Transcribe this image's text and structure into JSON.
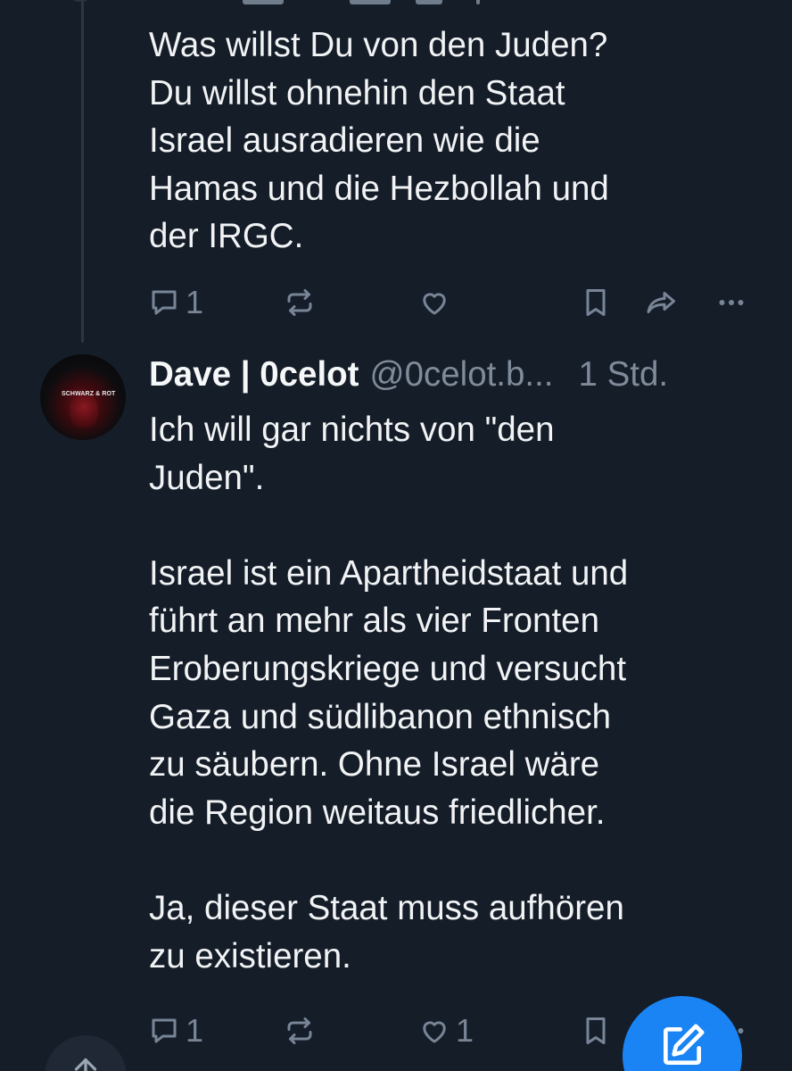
{
  "parent_post": {
    "text": "Was willst Du von den Juden?\nDu willst ohnehin den Staat\nIsrael ausradieren wie die\nHamas und die Hezbollah und\nder IRGC.",
    "reply_count": "1",
    "repost_count": "",
    "like_count": ""
  },
  "reply_post": {
    "author_name": "Dave | 0celot",
    "handle": "@0celot.b...",
    "time": "1 Std.",
    "avatar_text": "SCHWARZ & ROT",
    "text": "Ich will gar nichts von \"den\nJuden\".\n\nIsrael ist ein Apartheidstaat und\nführt an mehr als vier Fronten\nEroberungskriege und versucht\nGaza und südlibanon ethnisch\nzu säubern. Ohne Israel wäre\ndie Region weitaus friedlicher.\n\nJa, dieser Staat muss aufhören\nzu existieren.",
    "reply_count": "1",
    "repost_count": "",
    "like_count": "1"
  },
  "icons": {
    "reply": "speech-bubble-icon",
    "repost": "repost-arrows-icon",
    "like": "heart-icon",
    "bookmark": "bookmark-icon",
    "share": "share-arrow-icon",
    "more": "ellipsis-icon",
    "compose": "compose-pencil-icon",
    "scroll_top": "arrow-up-icon"
  },
  "colors": {
    "background": "#151d28",
    "text": "#f1f3f5",
    "muted": "#788597",
    "accent": "#1a84f4"
  }
}
